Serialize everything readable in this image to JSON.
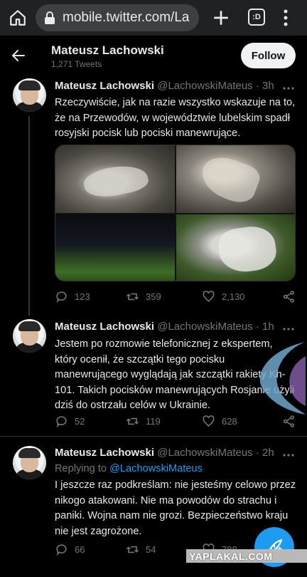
{
  "browser": {
    "url": "mobile.twitter.com/La",
    "tabs_label": ":D"
  },
  "header": {
    "name": "Mateusz Lachowski",
    "tweet_count": "1,271 Tweets",
    "follow_label": "Follow"
  },
  "tweets": [
    {
      "name": "Mateusz Lachowski",
      "handle": "@LachowskiMateus · 3h",
      "text": "Rzeczywiście, jak na razie wszystko wskazuje na to, że na Przewodów, w województwie lubelskim spadł rosyjski pocisk lub pociski manewrujące.",
      "replies": "123",
      "retweets": "359",
      "likes": "2,130"
    },
    {
      "name": "Mateusz Lachowski",
      "handle": "@LachowskiMateus · 1h",
      "text": "Jestem po rozmowie telefonicznej z ekspertem, który ocenił, że szczątki tego pocisku manewrującego wyglądają jak szczątki rakiety Kh-101. Takich pocisków manewrujących Rosjanie użyli dziś do ostrzału celów w Ukrainie.",
      "replies": "52",
      "retweets": "119",
      "likes": "628"
    },
    {
      "name": "Mateusz Lachowski",
      "handle": "@LachowskiMateus · 2h",
      "replying_prefix": "Replying to",
      "replying_to": "@LachowskiMateus",
      "text": "I jeszcze raz podkreślam: nie jesteśmy celowo przez nikogo atakowani. Nie ma powodów do strachu i paniki. Wojna nam nie grozi. Bezpieczeństwo kraju nie jest zagrożone.",
      "replies": "66",
      "retweets": "54",
      "likes": "788"
    }
  ],
  "watermark": "YAPLAKAL.COM",
  "colors": {
    "background": "#000000",
    "accent": "#1d9bf0",
    "muted": "#71767b",
    "text": "#e7e9ea"
  },
  "icons": [
    "home-icon",
    "lock-icon",
    "plus-icon",
    "tabs-icon",
    "kebab-icon",
    "back-arrow-icon",
    "more-icon",
    "reply-icon",
    "retweet-icon",
    "like-icon",
    "share-icon",
    "compose-icon"
  ]
}
